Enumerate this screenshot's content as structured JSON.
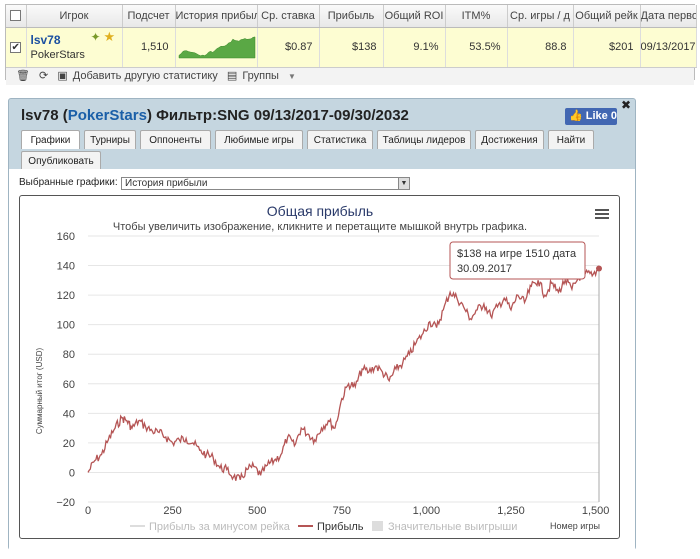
{
  "stats": {
    "headers": [
      "Игрок",
      "Подсчет",
      "История прибыли",
      "Ср. ставка",
      "Прибыль",
      "Общий ROI",
      "ITM%",
      "Ср. игры / д",
      "Общий рейк",
      "Дата первой"
    ],
    "row": {
      "player": "lsv78",
      "site": "PokerStars",
      "count": "1,510",
      "avg_stake": "$0.87",
      "profit": "$138",
      "roi": "9.1%",
      "itm": "53.5%",
      "games_per_day": "88.8",
      "rake": "$201",
      "first_date": "09/13/2017"
    },
    "footer": {
      "add_stat": "Добавить другую статистику",
      "groups": "Группы"
    }
  },
  "panel": {
    "player": "lsv78",
    "site": "PokerStars",
    "filter": "Фильтр:SNG 09/13/2017-09/30/2032",
    "like_label": "Like",
    "like_count": "0",
    "tabs": [
      "Графики",
      "Турниры",
      "Оппоненты",
      "Любимые игры",
      "Статистика",
      "Таблицы лидеров",
      "Достижения",
      "Найти",
      "Опубликовать"
    ],
    "selected_label": "Выбранные графики:",
    "selected_value": "История прибыли"
  },
  "chart_data": {
    "type": "line",
    "title": "Общая прибыль",
    "subtitle": "Чтобы увеличить изображение, кликните и перетащите мышкой внутрь графика.",
    "xlabel": "Номер игры",
    "ylabel": "Суммарный итог (USD)",
    "xlim": [
      0,
      1510
    ],
    "ylim": [
      -20,
      160
    ],
    "xticks": [
      "0",
      "250",
      "500",
      "750",
      "1,000",
      "1,250",
      "1,500"
    ],
    "yticks": [
      "160",
      "140",
      "120",
      "100",
      "80",
      "60",
      "40",
      "20",
      "0",
      "−20"
    ],
    "legend": [
      "Прибыль за минусом рейка",
      "Прибыль",
      "Значительные выигрыши"
    ],
    "tooltip_line1": "$138 на игре 1510 дата",
    "tooltip_line2": "30.09.2017",
    "series": [
      {
        "name": "Прибыль",
        "color": "#b55555",
        "x": [
          0,
          20,
          40,
          60,
          80,
          100,
          115,
          130,
          150,
          170,
          190,
          210,
          230,
          250,
          270,
          290,
          310,
          330,
          350,
          370,
          390,
          410,
          430,
          450,
          470,
          490,
          510,
          530,
          550,
          570,
          590,
          610,
          630,
          650,
          670,
          690,
          710,
          730,
          750,
          770,
          790,
          810,
          830,
          850,
          870,
          890,
          910,
          930,
          950,
          970,
          990,
          1010,
          1030,
          1050,
          1070,
          1090,
          1110,
          1130,
          1150,
          1170,
          1190,
          1210,
          1230,
          1250,
          1270,
          1290,
          1310,
          1330,
          1350,
          1370,
          1390,
          1410,
          1430,
          1450,
          1470,
          1490,
          1510
        ],
        "y": [
          0,
          8,
          12,
          22,
          30,
          37,
          35,
          30,
          35,
          31,
          28,
          27,
          24,
          20,
          22,
          23,
          20,
          15,
          12,
          10,
          3,
          2,
          -3,
          -5,
          2,
          4,
          -2,
          5,
          8,
          12,
          24,
          18,
          30,
          26,
          22,
          30,
          35,
          30,
          50,
          60,
          58,
          70,
          68,
          72,
          68,
          62,
          70,
          74,
          80,
          88,
          94,
          102,
          98,
          110,
          122,
          118,
          112,
          104,
          110,
          114,
          106,
          112,
          118,
          110,
          120,
          115,
          126,
          130,
          120,
          128,
          122,
          130,
          124,
          132,
          135,
          133,
          138
        ]
      }
    ]
  }
}
